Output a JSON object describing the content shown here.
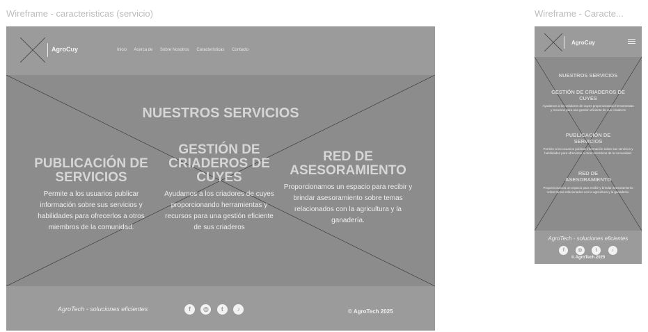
{
  "desktop": {
    "frame_label": "Wireframe - caracteristicas (servicio)",
    "brand": "AgroCuy",
    "nav": [
      "Inicio",
      "Acerca de",
      "Sobre Nosotros",
      "Características",
      "Contacto"
    ],
    "section_title": "NUESTROS SERVICIOS",
    "services": [
      {
        "title": "PUBLICACIÓN DE SERVICIOS",
        "text": "Permite a los usuarios publicar información sobre sus servicios y habilidades para ofrecerlos a otros miembros de la comunidad."
      },
      {
        "title": "GESTIÓN DE CRIADEROS DE CUYES",
        "text": "Ayudamos a los criadores de cuyes proporcionando herramientas y recursos para una gestión eficiente de sus criaderos"
      },
      {
        "title": "RED DE ASESORAMIENTO",
        "text": "Proporcionamos un espacio para recibir y brindar asesoramiento sobre temas relacionados con la agricultura y la ganadería."
      }
    ],
    "footer_tagline": "AgroTech - soluciones eficientes",
    "copyright": "© AgroTech 2025"
  },
  "mobile": {
    "frame_label": "Wireframe - Caracte...",
    "brand": "AgroCuy",
    "section_title": "NUESTROS SERVICIOS",
    "services": [
      {
        "title": "GESTIÓN DE CRIADEROS DE CUYES",
        "text": "Ayudamos a los criadores de cuyes proporcionando herramientas y recursos para una gestión eficiente de sus criaderos"
      },
      {
        "title": "PUBLICACIÓN DE SERVICIOS",
        "text": "Permite a los usuarios publicar información sobre sus servicios y habilidades para ofrecerlos a otros miembros de la comunidad."
      },
      {
        "title": "RED DE ASESORAMIENTO",
        "text": "Proporcionamos un espacio para recibir y brindar asesoramiento sobre temas relacionados con la agricultura y la ganadería."
      }
    ],
    "footer_tagline": "AgroTech - soluciones eficientes",
    "copyright": "© AgroTech 2025"
  },
  "social_icons": [
    "facebook-icon",
    "instagram-icon",
    "twitter-icon",
    "tiktok-icon"
  ],
  "colors": {
    "frame_bg": "#9e9e9e",
    "hero_bg": "#8c8c8c",
    "placeholder_lines": "#3a3a3a"
  }
}
